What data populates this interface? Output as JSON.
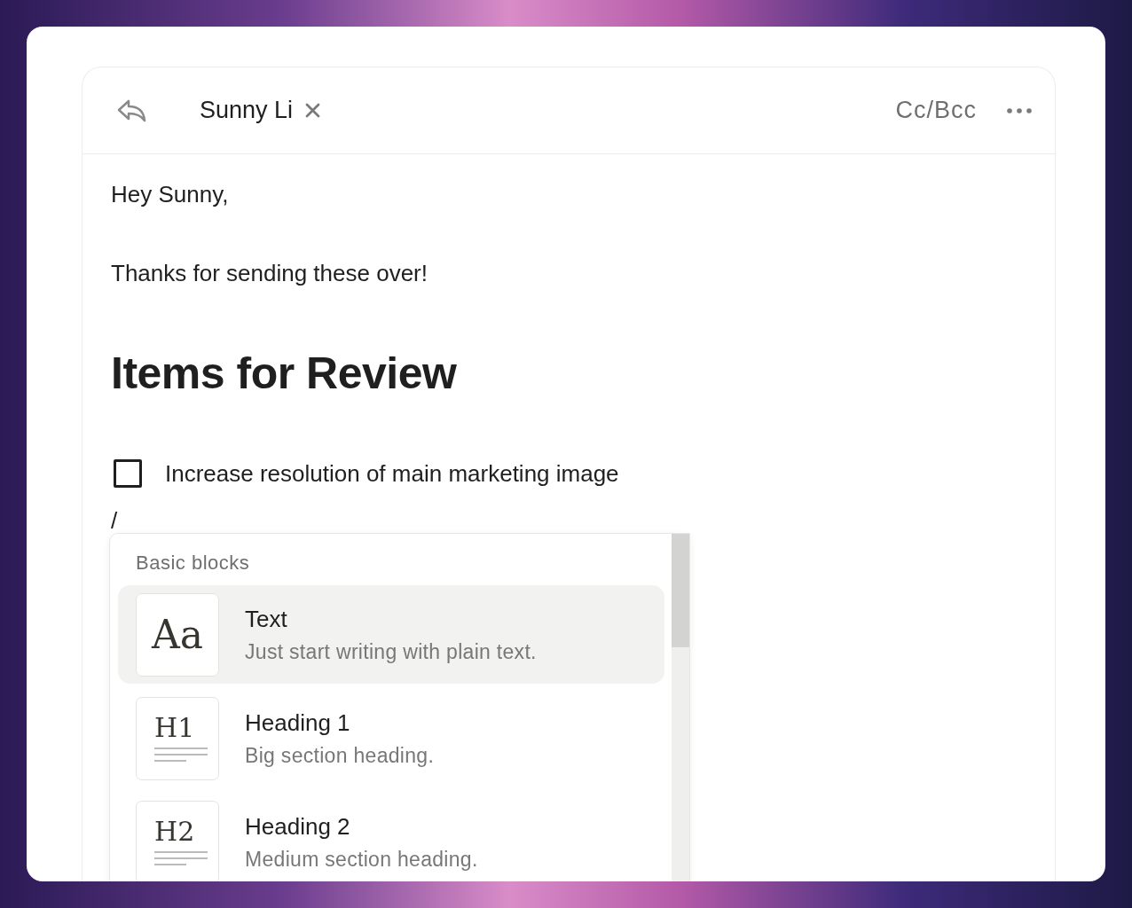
{
  "header": {
    "recipient": "Sunny Li",
    "cc_bcc": "Cc/Bcc"
  },
  "body": {
    "greeting": "Hey Sunny,",
    "message": "Thanks for sending these over!",
    "heading": "Items for Review",
    "checklist": [
      {
        "label": "Increase resolution of main marketing image",
        "checked": false
      }
    ],
    "command": "/"
  },
  "menu": {
    "section": "Basic blocks",
    "items": [
      {
        "kind": "text",
        "glyph": "Aa",
        "title": "Text",
        "description": "Just start writing with plain text.",
        "selected": true
      },
      {
        "kind": "heading",
        "glyph": "H1",
        "title": "Heading 1",
        "description": "Big section heading.",
        "selected": false
      },
      {
        "kind": "heading",
        "glyph": "H2",
        "title": "Heading 2",
        "description": "Medium section heading.",
        "selected": false
      }
    ]
  }
}
